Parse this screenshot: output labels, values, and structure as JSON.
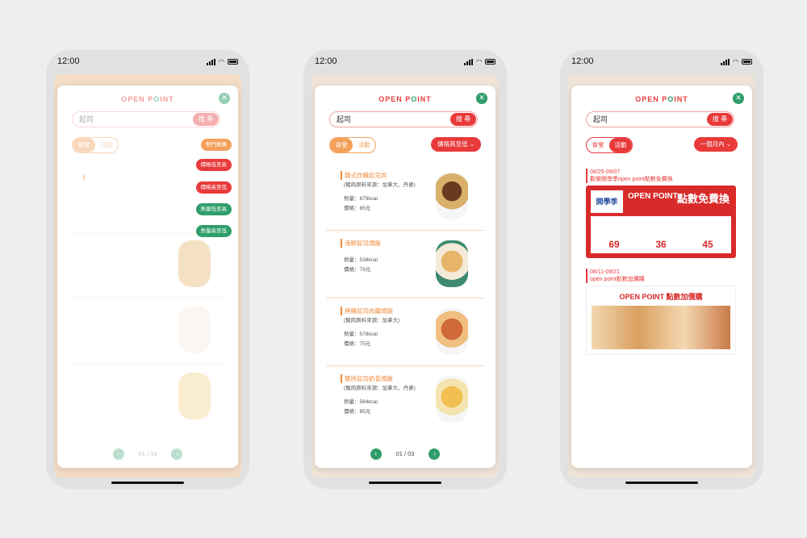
{
  "status": {
    "time": "12:00"
  },
  "logo": {
    "text_a": "OPEN P",
    "text_b": "O",
    "text_c": "INT"
  },
  "search": {
    "value": "起司",
    "button": "搜 尋"
  },
  "tabs": {
    "food": "食堂",
    "event": "活動"
  },
  "phone1": {
    "sort_options": [
      "熱門推薦",
      "價格低至高",
      "價格高至低",
      "熱量低至高",
      "熱量高至低"
    ],
    "colors": {
      "orange": "#f3a05a",
      "red": "#e83a3a",
      "green": "#2f9e6a"
    }
  },
  "phone2": {
    "sort_button": "價格高至低 ⌄",
    "items": [
      {
        "name": "韓式炸雞起司丼",
        "source": "(豬肉原料來源：加拿大、丹麥)",
        "calories": "熱量：679kcal",
        "price": "價格：85元"
      },
      {
        "name": "海鮮起司焗飯",
        "source": "",
        "calories": "熱量：538kcal",
        "price": "價格：79元"
      },
      {
        "name": "烤雞起司肉醬焗飯",
        "source": "(豬肉原料來源：加拿大)",
        "calories": "熱量：578kcal",
        "price": "價格：75元"
      },
      {
        "name": "雙拼起司奶香焗飯",
        "source": "(豬肉原料來源：加拿大、丹麥)",
        "calories": "熱量：584kcal",
        "price": "價格：85元"
      }
    ],
    "pager": "01 / 03"
  },
  "phone3": {
    "sort_button": "一個月內 ⌄",
    "events": [
      {
        "date": "08/25-09/07",
        "title": "歡樂開學季open point點數免費換"
      },
      {
        "date": "08/11-09/21",
        "title": "open point點數加價購"
      }
    ],
    "banner1": {
      "title": "OPEN POINT",
      "sub": "點數免費換",
      "badge": "開學季",
      "points": [
        "69",
        "36",
        "45"
      ]
    },
    "banner2": {
      "title": "OPEN POINT 點數加價購"
    }
  }
}
